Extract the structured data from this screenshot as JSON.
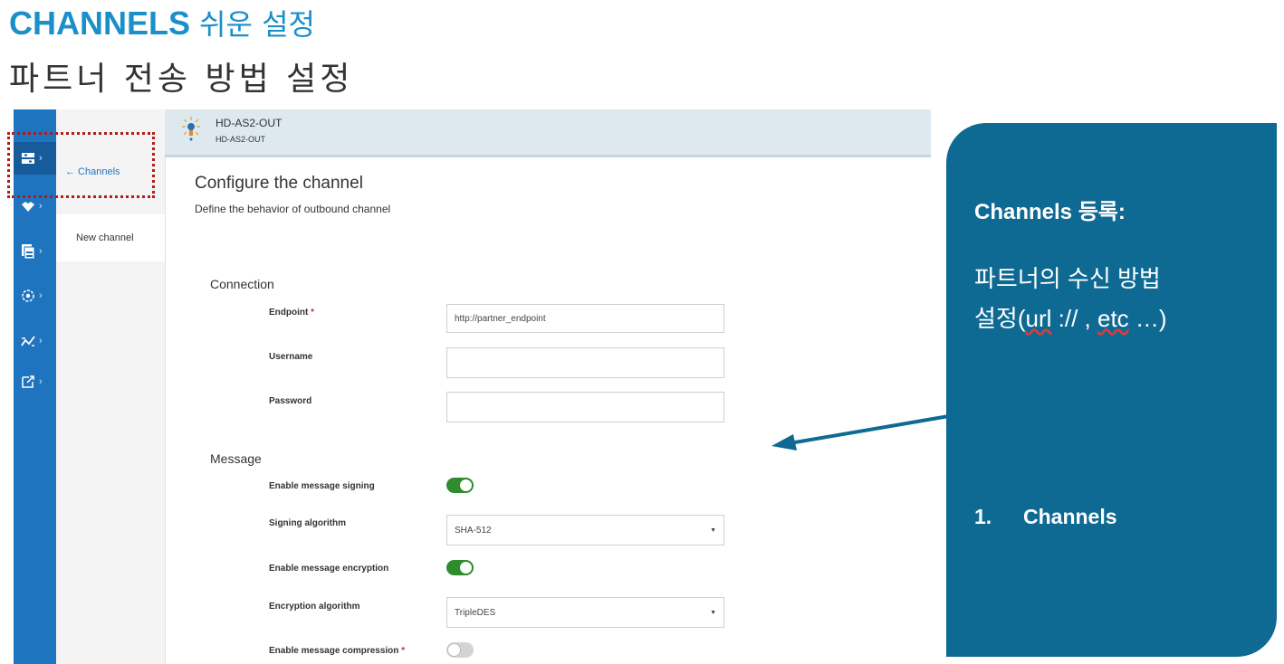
{
  "slide": {
    "title_en": "CHANNELS",
    "title_ko": "쉬운 설정",
    "subtitle": "파트너 전송 방법 설정"
  },
  "app": {
    "rail": {
      "icons": [
        "channels-icon",
        "partners-icon",
        "documents-icon",
        "settings-icon",
        "routing-icon",
        "export-icon"
      ],
      "chevron": "›"
    },
    "subnav": {
      "back_label": "← Channels",
      "current_item": "New channel"
    },
    "header": {
      "name": "HD-AS2-OUT",
      "subname": "HD-AS2-OUT"
    },
    "page": {
      "title": "Configure the channel",
      "description": "Define the behavior of outbound channel"
    },
    "connection": {
      "section_label": "Connection",
      "endpoint_label": "Endpoint",
      "required_mark": "*",
      "endpoint_value": "http://partner_endpoint",
      "username_label": "Username",
      "username_value": "",
      "password_label": "Password",
      "password_value": ""
    },
    "message": {
      "section_label": "Message",
      "signing_label": "Enable message signing",
      "signing_enabled": true,
      "signing_algorithm_label": "Signing algorithm",
      "signing_algorithm_value": "SHA-512",
      "encryption_label": "Enable message encryption",
      "encryption_enabled": true,
      "encryption_algorithm_label": "Encryption algorithm",
      "encryption_algorithm_value": "TripleDES",
      "compression_label": "Enable message compression",
      "compression_enabled": false
    },
    "colors": {
      "rail": "#1f74c0",
      "toggle_on": "#2e8b2e",
      "highlight": "#b01c1c"
    }
  },
  "callout": {
    "heading": "Channels 등록:",
    "line1": "파트너의 수신 방법",
    "line2_prefix": "설정(",
    "line2_url": "url",
    "line2_mid": " :// , ",
    "line2_etc": "etc",
    "line2_suffix": " …)",
    "step_number": "1.",
    "step_label": "Channels",
    "color": "#0f6a93"
  }
}
